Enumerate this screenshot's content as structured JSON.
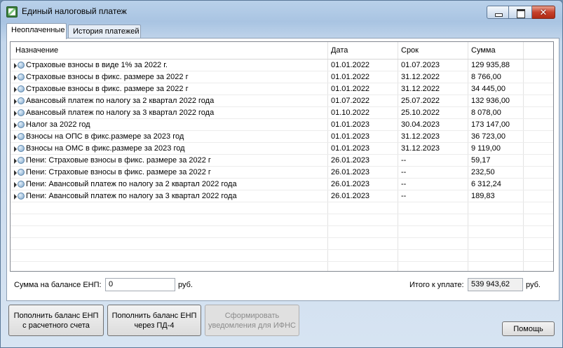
{
  "window": {
    "title": "Единый налоговый платеж"
  },
  "tabs": [
    {
      "label": "Неоплаченные"
    },
    {
      "label": "История платежей"
    }
  ],
  "table": {
    "columns": [
      "Назначение",
      "Дата",
      "Срок",
      "Сумма"
    ],
    "rows": [
      {
        "purpose": "Страховые взносы в виде 1% за 2022 г.",
        "date": "01.01.2022",
        "due": "01.07.2023",
        "amount": "129 935,88"
      },
      {
        "purpose": "Страховые взносы в фикс. размере за 2022 г",
        "date": "01.01.2022",
        "due": "31.12.2022",
        "amount": "8 766,00"
      },
      {
        "purpose": "Страховые взносы в фикс. размере за 2022 г",
        "date": "01.01.2022",
        "due": "31.12.2022",
        "amount": "34 445,00"
      },
      {
        "purpose": "Авансовый платеж по налогу за 2 квартал 2022 года",
        "date": "01.07.2022",
        "due": "25.07.2022",
        "amount": "132 936,00"
      },
      {
        "purpose": "Авансовый платеж по налогу за 3 квартал 2022 года",
        "date": "01.10.2022",
        "due": "25.10.2022",
        "amount": "8 078,00"
      },
      {
        "purpose": "Налог за 2022 год",
        "date": "01.01.2023",
        "due": "30.04.2023",
        "amount": "173 147,00"
      },
      {
        "purpose": "Взносы на ОПС в фикс.размере за 2023 год",
        "date": "01.01.2023",
        "due": "31.12.2023",
        "amount": "36 723,00"
      },
      {
        "purpose": "Взносы на ОМС в фикс.размере за 2023 год",
        "date": "01.01.2023",
        "due": "31.12.2023",
        "amount": "9 119,00"
      },
      {
        "purpose": "Пени: Страховые взносы в фикс. размере за 2022 г",
        "date": "26.01.2023",
        "due": "--",
        "amount": "59,17"
      },
      {
        "purpose": "Пени: Страховые взносы в фикс. размере за 2022 г",
        "date": "26.01.2023",
        "due": "--",
        "amount": "232,50"
      },
      {
        "purpose": "Пени: Авансовый платеж по налогу за 2 квартал 2022 года",
        "date": "26.01.2023",
        "due": "--",
        "amount": "6 312,24"
      },
      {
        "purpose": "Пени: Авансовый платеж по налогу за 3 квартал 2022 года",
        "date": "26.01.2023",
        "due": "--",
        "amount": "189,83"
      }
    ],
    "empty_rows": 6
  },
  "footer": {
    "balance_label": "Сумма на балансе ЕНП:",
    "balance_value": "0",
    "balance_unit": "руб.",
    "total_label": "Итого к уплате:",
    "total_value": "539 943,62",
    "total_unit": "руб."
  },
  "buttons": {
    "topup_account": "Пополнить баланс ЕНП с расчетного счета",
    "topup_pd4": "Пополнить баланс ЕНП через ПД-4",
    "form_notice": "Сформировать уведомления для ИФНС",
    "help": "Помощь"
  },
  "icons": {
    "window": "app-icon",
    "row": "info-circle-icon",
    "expand": "triangle-right-icon"
  }
}
